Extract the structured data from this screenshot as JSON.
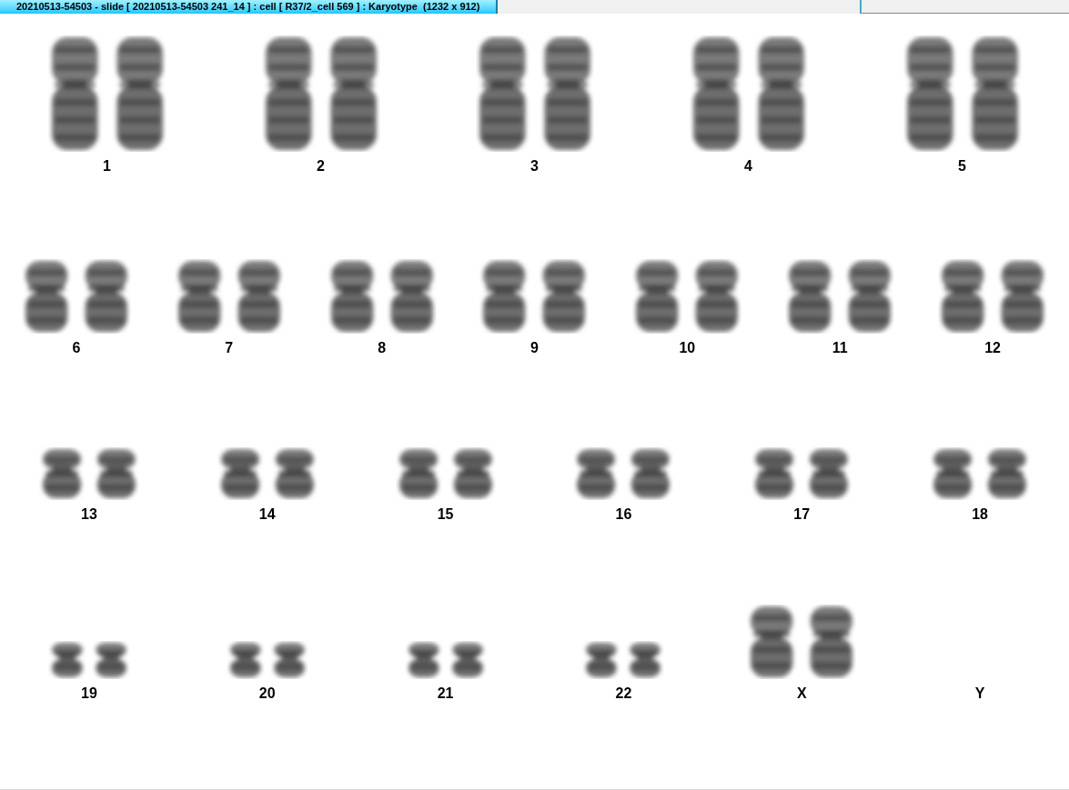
{
  "tabs": [
    {
      "label": "20210513-54503 - slide [ 20210513-54503 241_14 ] : cell [ R37/2_cell 569 ] : Karyotype  (1232 x 912)",
      "selected": true
    },
    {
      "selected": false
    }
  ],
  "karyotype_rows": [
    {
      "chromosomes": [
        {
          "label": "1",
          "kind": "long"
        },
        {
          "label": "2",
          "kind": "long"
        },
        {
          "label": "3",
          "kind": "long"
        },
        {
          "label": "4",
          "kind": "long"
        },
        {
          "label": "5",
          "kind": "long"
        }
      ]
    },
    {
      "chromosomes": [
        {
          "label": "6",
          "kind": "medium"
        },
        {
          "label": "7",
          "kind": "medium"
        },
        {
          "label": "8",
          "kind": "medium"
        },
        {
          "label": "9",
          "kind": "medium"
        },
        {
          "label": "10",
          "kind": "medium"
        },
        {
          "label": "11",
          "kind": "medium"
        },
        {
          "label": "12",
          "kind": "medium"
        }
      ]
    },
    {
      "chromosomes": [
        {
          "label": "13",
          "kind": "short"
        },
        {
          "label": "14",
          "kind": "short"
        },
        {
          "label": "15",
          "kind": "short"
        },
        {
          "label": "16",
          "kind": "short"
        },
        {
          "label": "17",
          "kind": "short"
        },
        {
          "label": "18",
          "kind": "short"
        }
      ]
    },
    {
      "chromosomes": [
        {
          "label": "19",
          "kind": "tiny"
        },
        {
          "label": "20",
          "kind": "tiny"
        },
        {
          "label": "21",
          "kind": "tiny"
        },
        {
          "label": "22",
          "kind": "tiny"
        },
        {
          "label": "X",
          "kind": "medium"
        },
        {
          "label": "Y",
          "kind": "empty"
        }
      ]
    }
  ]
}
